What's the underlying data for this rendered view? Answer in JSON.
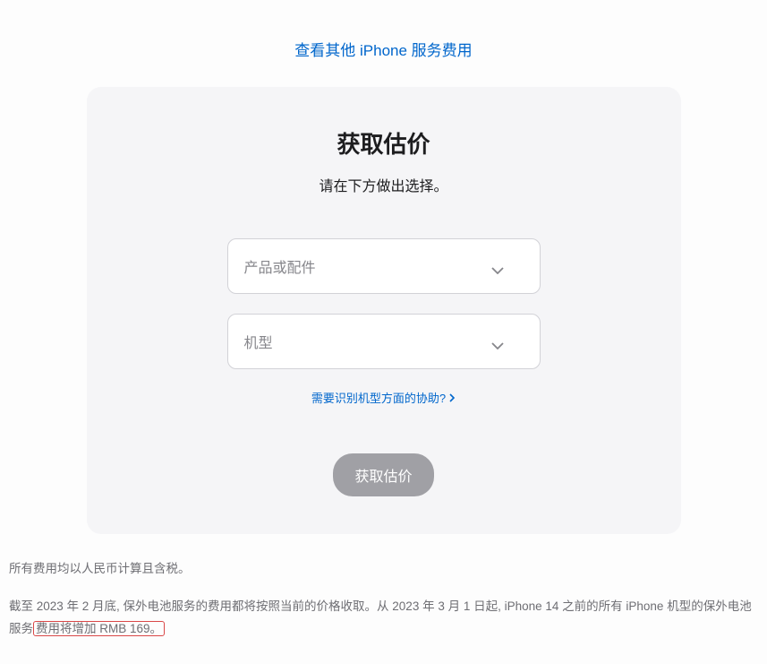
{
  "header": {
    "link_text": "查看其他 iPhone 服务费用"
  },
  "card": {
    "title": "获取估价",
    "subtitle": "请在下方做出选择。",
    "select_product_placeholder": "产品或配件",
    "select_model_placeholder": "机型",
    "help_link_text": "需要识别机型方面的协助?",
    "submit_button_label": "获取估价"
  },
  "footer": {
    "note1": "所有费用均以人民币计算且含税。",
    "note2_part1": "截至 2023 年 2 月底, 保外电池服务的费用都将按照当前的价格收取。从 2023 年 3 月 1 日起, iPhone 14 之前的所有 iPhone 机型的保外电池服务",
    "note2_highlight": "费用将增加 RMB 169。"
  }
}
